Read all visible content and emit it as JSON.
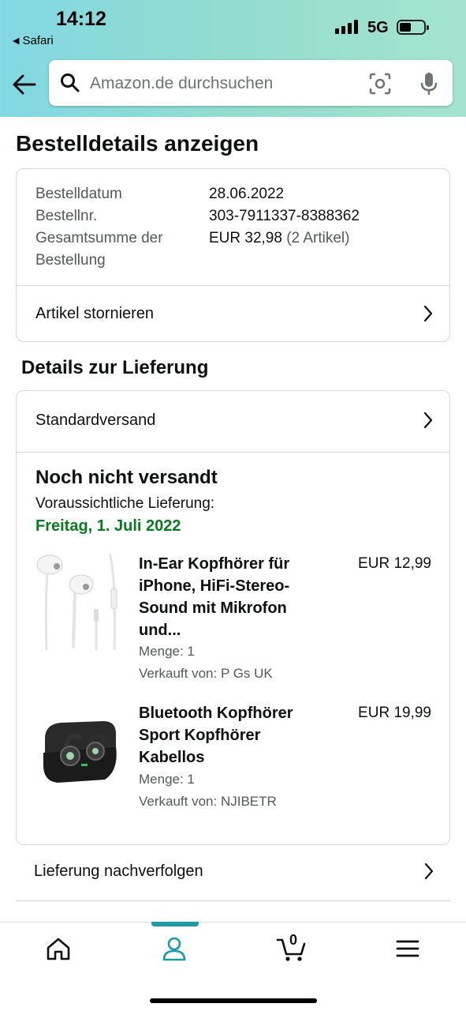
{
  "status_bar": {
    "time": "14:12",
    "back_app": "Safari",
    "network": "5G"
  },
  "search": {
    "placeholder": "Amazon.de durchsuchen"
  },
  "page_title": "Bestelldetails anzeigen",
  "order_summary": {
    "date_label": "Bestelldatum",
    "date_value": "28.06.2022",
    "number_label": "Bestellnr.",
    "number_value": "303-7911337-8388362",
    "total_label_1": "Gesamtsumme der",
    "total_label_2": "Bestellung",
    "total_value": "EUR 32,98",
    "total_count": "(2 Artikel)",
    "cancel_link": "Artikel stornieren"
  },
  "delivery": {
    "section_title": "Details zur Lieferung",
    "shipping_method": "Standardversand",
    "status": "Noch nicht versandt",
    "expected_label": "Voraussichtliche Lieferung:",
    "expected_date": "Freitag, 1. Juli 2022",
    "accent_green": "#0a7a1f",
    "items": [
      {
        "title": "In-Ear Kopfhörer für iPhone, HiFi-Stereo-Sound mit Mikrofon und...",
        "price": "EUR 12,99",
        "quantity": "Menge: 1",
        "seller": "Verkauft von: P Gs UK"
      },
      {
        "title": "Bluetooth Kopfhörer Sport Kopfhörer Kabellos",
        "price": "EUR 19,99",
        "quantity": "Menge: 1",
        "seller": "Verkauft von: NJIBETR"
      }
    ]
  },
  "links": {
    "track": "Lieferung nachverfolgen"
  },
  "bottom_nav": {
    "cart_count": "0",
    "active_color": "#1e9aa6"
  }
}
